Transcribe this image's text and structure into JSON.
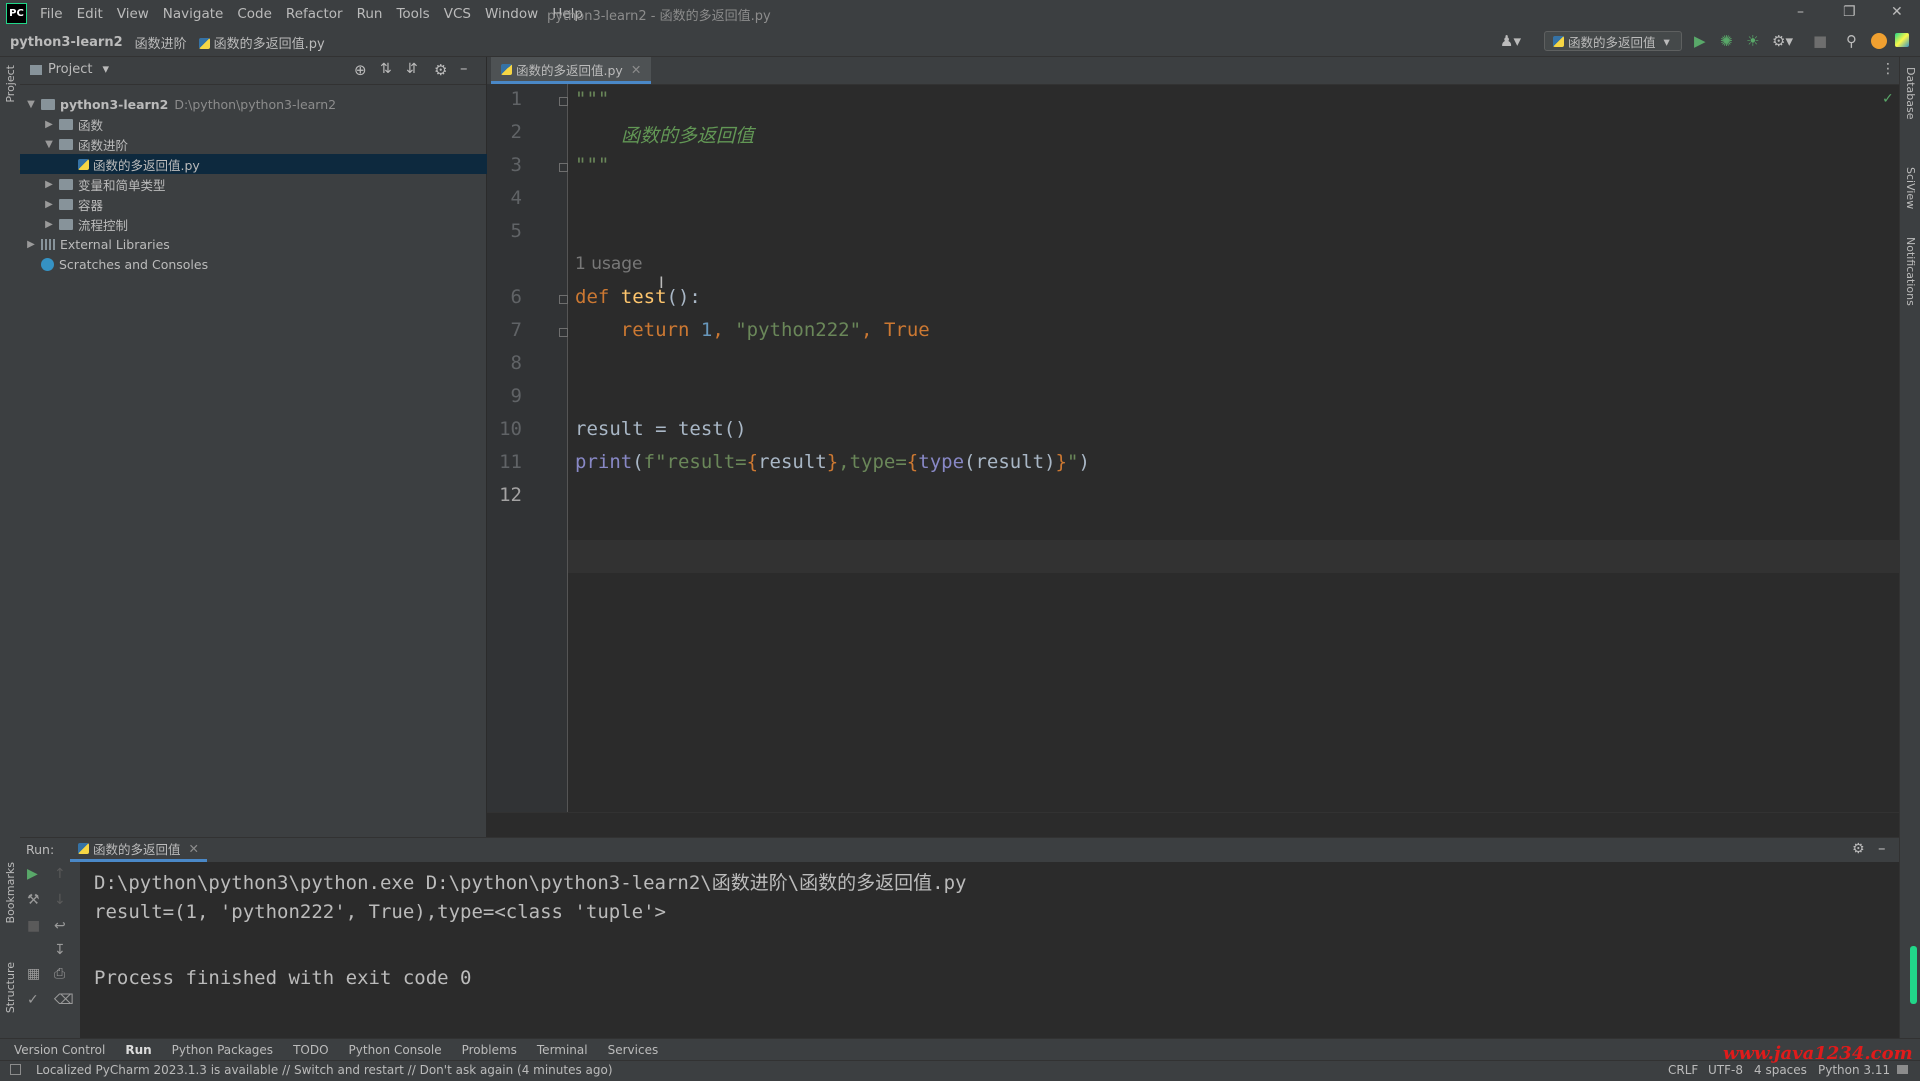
{
  "app": {
    "logo": "PC",
    "window_title": "python3-learn2 - 函数的多返回值.py"
  },
  "menu": [
    "File",
    "Edit",
    "View",
    "Navigate",
    "Code",
    "Refactor",
    "Run",
    "Tools",
    "VCS",
    "Window",
    "Help"
  ],
  "breadcrumb": {
    "project": "python3-learn2",
    "folder": "函数进阶",
    "file": "函数的多返回值.py"
  },
  "run_config": {
    "label": "函数的多返回值"
  },
  "left_strip": {
    "project": "Project",
    "bookmarks": "Bookmarks",
    "structure": "Structure"
  },
  "right_strip": {
    "database": "Database",
    "sciview": "SciView",
    "notifications": "Notifications"
  },
  "project_panel": {
    "title": "Project",
    "tree": [
      {
        "label": "python3-learn2",
        "path": "D:\\python\\python3-learn2"
      },
      {
        "label": "函数"
      },
      {
        "label": "函数进阶"
      },
      {
        "label": "函数的多返回值.py"
      },
      {
        "label": "变量和简单类型"
      },
      {
        "label": "容器"
      },
      {
        "label": "流程控制"
      },
      {
        "label": "External Libraries"
      },
      {
        "label": "Scratches and Consoles"
      }
    ]
  },
  "editor": {
    "tab": "函数的多返回值.py",
    "line_numbers": [
      "1",
      "2",
      "3",
      "4",
      "5",
      "6",
      "7",
      "8",
      "9",
      "10",
      "11",
      "12"
    ],
    "current_line": "12",
    "usage_hint": "1 usage",
    "code": {
      "l1": "\"\"\"",
      "l2": "函数的多返回值",
      "l3": "\"\"\"",
      "l6_def": "def",
      "l6_name": "test",
      "l6_rest": "():",
      "l7_return": "return",
      "l7_num": "1",
      "l7_c1": ", ",
      "l7_str": "\"python222\"",
      "l7_c2": ", ",
      "l7_true": "True",
      "l10": "result = test()",
      "l11_print": "print",
      "l11_p1": "(",
      "l11_f": "f\"result=",
      "l11_b1": "{",
      "l11_v1": "result",
      "l11_b2": "}",
      "l11_mid": ",type=",
      "l11_b3": "{",
      "l11_type": "type",
      "l11_v2": "(result)",
      "l11_b4": "}",
      "l11_end": "\"",
      "l11_p2": ")"
    }
  },
  "run_panel": {
    "label": "Run:",
    "tab": "函数的多返回值",
    "output": [
      "D:\\python\\python3\\python.exe D:\\python\\python3-learn2\\函数进阶\\函数的多返回值.py",
      "result=(1, 'python222', True),type=<class 'tuple'>",
      "",
      "Process finished with exit code 0"
    ]
  },
  "tool_tabs": [
    "Version Control",
    "Run",
    "Python Packages",
    "TODO",
    "Python Console",
    "Problems",
    "Terminal",
    "Services"
  ],
  "status": {
    "message": "Localized PyCharm 2023.1.3 is available // Switch and restart // Don't ask again (4 minutes ago)",
    "line_sep": "CRLF",
    "encoding": "UTF-8",
    "indent": "4 spaces",
    "interpreter": "Python 3.11"
  },
  "watermark": "www.java1234.com"
}
